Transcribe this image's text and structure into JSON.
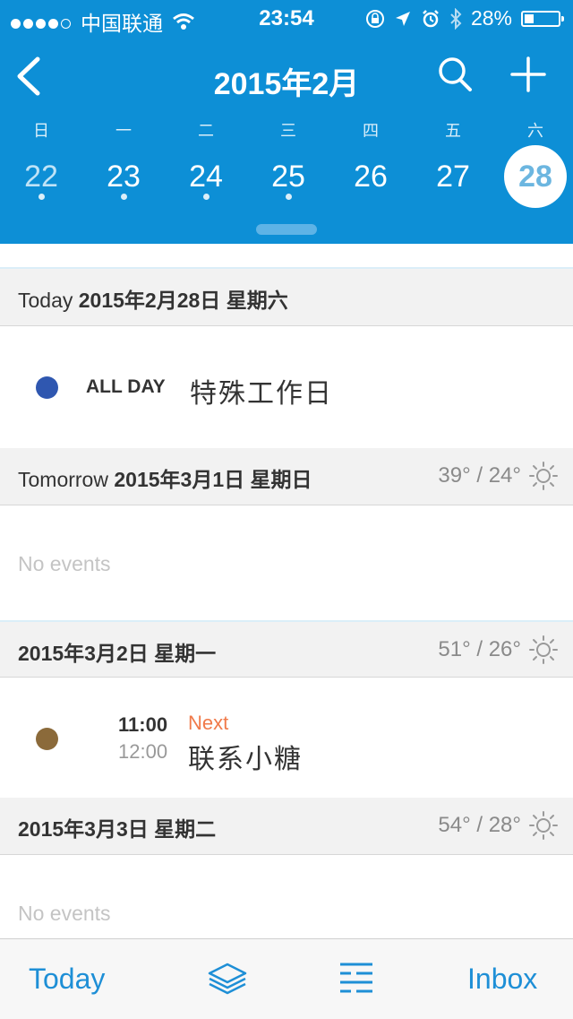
{
  "status_bar": {
    "carrier": "中国联通",
    "time": "23:54",
    "battery": "28%",
    "battery_level": 0.28
  },
  "header": {
    "title": "2015年2月",
    "weekdays": [
      "日",
      "一",
      "二",
      "三",
      "四",
      "五",
      "六"
    ],
    "days": [
      {
        "num": "22",
        "has_events": true,
        "state": "past"
      },
      {
        "num": "23",
        "has_events": true,
        "state": "normal"
      },
      {
        "num": "24",
        "has_events": true,
        "state": "normal"
      },
      {
        "num": "25",
        "has_events": true,
        "state": "normal"
      },
      {
        "num": "26",
        "has_events": false,
        "state": "normal"
      },
      {
        "num": "27",
        "has_events": false,
        "state": "normal"
      },
      {
        "num": "28",
        "has_events": false,
        "state": "selected"
      }
    ],
    "accent_color": "#0d8fd6"
  },
  "sections": {
    "today": {
      "prefix": "Today",
      "date": "2015年2月28日 星期六",
      "event": {
        "tag": "ALL DAY",
        "title": "特殊工作日",
        "color": "#2f57b0"
      }
    },
    "tomorrow": {
      "prefix": "Tomorrow",
      "date": "2015年3月1日 星期日",
      "weather": "39° / 24°",
      "weather_icon": "sun-icon",
      "empty_text": "No events"
    },
    "mar2": {
      "date": "2015年3月2日 星期一",
      "weather": "51° / 26°",
      "weather_icon": "sun-icon",
      "event": {
        "start": "11:00",
        "end": "12:00",
        "badge": "Next",
        "title": "联系小糖",
        "color": "#8b6a3a"
      }
    },
    "mar3": {
      "date": "2015年3月3日 星期二",
      "weather": "54° / 28°",
      "weather_icon": "sun-icon",
      "empty_text": "No events"
    }
  },
  "tabbar": {
    "today": "Today",
    "layers_icon": "layers-icon",
    "list_icon": "list-icon",
    "inbox": "Inbox"
  }
}
